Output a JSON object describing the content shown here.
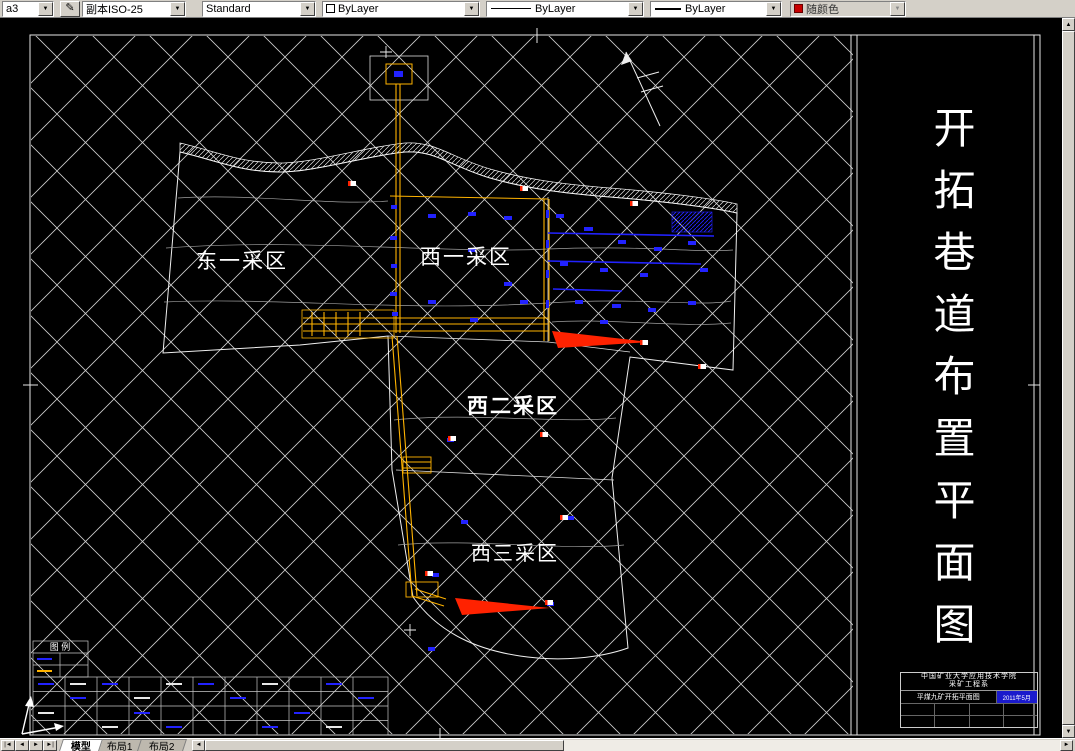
{
  "toolbar": {
    "combos": [
      {
        "value": "a3"
      },
      {
        "value": "副本ISO-25"
      },
      {
        "value": "Standard"
      },
      {
        "value": "ByLayer"
      },
      {
        "value": "ByLayer"
      },
      {
        "value": "ByLayer"
      },
      {
        "value": "随颜色"
      }
    ]
  },
  "icons": {
    "chevron_down": "▼",
    "pencil": "✎",
    "up_arrow": "▲",
    "down_arrow": "▼",
    "left_arrow": "◄",
    "right_arrow": "►"
  },
  "drawing": {
    "vertical_title": "开拓巷道布置平面图",
    "area_labels": [
      "东一采区",
      "西一采区",
      "西二采区",
      "西三采区"
    ],
    "legend_title": "图 例",
    "title_block": {
      "org_line1": "中国矿业大学应用技术学院",
      "org_line2": "采矿工程系",
      "drawing_title": "平煤九矿开拓平面图",
      "date": "2011年5月"
    }
  },
  "tabs": {
    "nav": [
      "|◄",
      "◄",
      "►",
      "►|"
    ],
    "items": [
      "模型",
      "布局1",
      "布局2"
    ]
  },
  "colors": {
    "roadway_yellow": "#ffb300",
    "working_blue": "#2222ff",
    "highlight_red": "#ff2200",
    "hatch_white": "#cfcfcf"
  }
}
